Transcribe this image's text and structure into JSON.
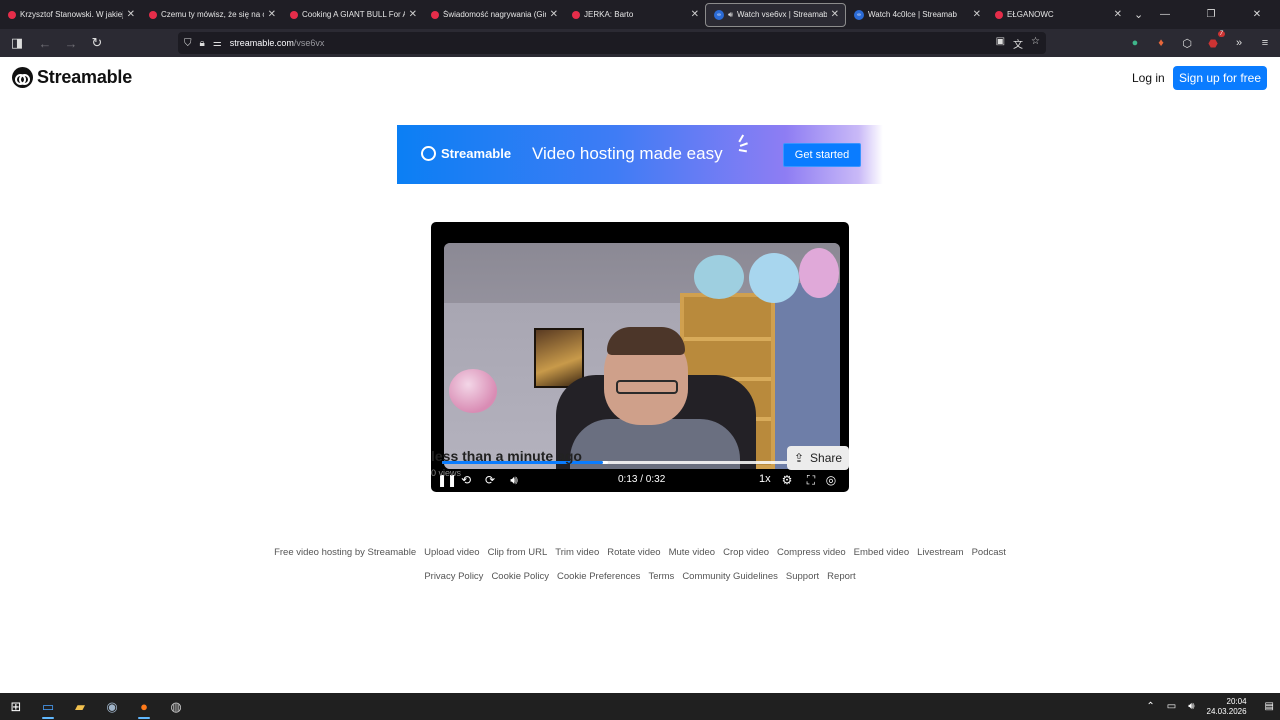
{
  "browser": {
    "tabs": [
      {
        "title": "Krzysztof Stanowski. W jakiej",
        "favicon": "youtube-icon",
        "active": false
      },
      {
        "title": "Czemu ty mówisz, że się na c",
        "favicon": "youtube-icon",
        "active": false
      },
      {
        "title": "Cooking A GIANT BULL For A",
        "favicon": "youtube-icon",
        "active": false
      },
      {
        "title": "Świadomość nagrywania (Gir",
        "favicon": "youtube-icon",
        "active": false
      },
      {
        "title": "JERKA: Barto",
        "favicon": "youtube-icon",
        "active": false
      },
      {
        "title": "Watch vse6vx | Streamab",
        "favicon": "streamable-icon",
        "active": true
      },
      {
        "title": "Watch 4c0lce | Streamab",
        "favicon": "streamable-icon",
        "active": false
      },
      {
        "title": "EŁGANOWC",
        "favicon": "youtube-icon",
        "active": false
      }
    ],
    "url_host": "streamable.com",
    "url_path": "/vse6vx",
    "extension_badge": "7"
  },
  "header": {
    "logo_text": "Streamable",
    "login_label": "Log in",
    "signup_label": "Sign up for free"
  },
  "banner": {
    "logo_text": "Streamable",
    "headline": "Video hosting made easy",
    "cta_label": "Get started"
  },
  "player": {
    "timecode": "0:13 / 0:32",
    "speed": "1x",
    "progress_fraction": 0.406,
    "buffered_fraction": 0.42
  },
  "video_meta": {
    "title": "less than a minute ago",
    "views": "0 views",
    "share_label": "Share"
  },
  "footer": {
    "row1": [
      "Free video hosting by Streamable",
      "Upload video",
      "Clip from URL",
      "Trim video",
      "Rotate video",
      "Mute video",
      "Crop video",
      "Compress video",
      "Embed video",
      "Livestream",
      "Podcast"
    ],
    "row2": [
      "Privacy Policy",
      "Cookie Policy",
      "Cookie Preferences",
      "Terms",
      "Community Guidelines",
      "Support",
      "Report"
    ]
  },
  "taskbar": {
    "time": "20:04",
    "date": "24.03.2026"
  },
  "colors": {
    "brand_blue": "#0a7cff",
    "progress": "#0a7cff",
    "page_bg": "#ffffff"
  }
}
